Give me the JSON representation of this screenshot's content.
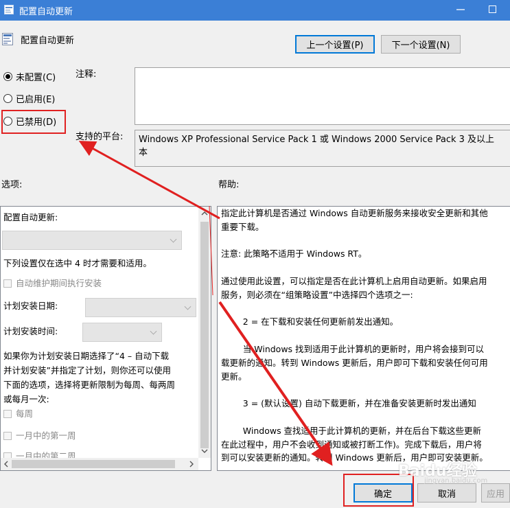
{
  "window": {
    "title": "配置自动更新",
    "header": "配置自动更新"
  },
  "nav": {
    "prev_label": "上一个设置(P)",
    "next_label": "下一个设置(N)"
  },
  "state": {
    "not_configured": "未配置(C)",
    "enabled": "已启用(E)",
    "disabled": "已禁用(D)",
    "selected": "not_configured"
  },
  "comment": {
    "label": "注释:",
    "value": ""
  },
  "platform": {
    "label": "支持的平台:",
    "value": "Windows XP Professional Service Pack 1 或 Windows 2000 Service Pack 3 及以上",
    "value_cont": "本"
  },
  "options": {
    "label": "选项:",
    "configure_label": "配置自动更新:",
    "configure_value": "",
    "note": "下列设置仅在选中 4 时才需要和适用。",
    "maintenance": "自动维护期间执行安装",
    "schedule_day_label": "计划安装日期:",
    "schedule_day_value": "",
    "schedule_time_label": "计划安装时间:",
    "schedule_time_value": "",
    "para": [
      "如果你为计划安装日期选择了“4 – 自动下载",
      "并计划安装”并指定了计划，则你还可以使用",
      "下面的选项，选择将更新限制为每周、每两周",
      "或每月一次:"
    ],
    "weekly": "每周",
    "first_week": "一月中的第一周",
    "second_week": "一月中的第二周"
  },
  "help": {
    "label": "帮助:",
    "lines": [
      "指定此计算机是否通过 Windows 自动更新服务来接收安全更新和其他",
      "重要下载。",
      "",
      "注意: 此策略不适用于 Windows RT。",
      "",
      "通过使用此设置，可以指定是否在此计算机上启用自动更新。如果启用",
      "服务，则必须在“组策略设置”中选择四个选项之一:",
      "",
      "        2 = 在下载和安装任何更新前发出通知。",
      "",
      "        当 Windows 找到适用于此计算机的更新时，用户将会接到可以",
      "载更新的通知。转到 Windows 更新后，用户即可下载和安装任何可用",
      "更新。",
      "",
      "        3 = (默认设置) 自动下载更新，并在准备安装更新时发出通知",
      "",
      "        Windows 查找适用于此计算机的更新，并在后台下载这些更新",
      "在此过程中，用户不会收到通知或被打断工作)。完成下载后，用户将",
      "到可以安装更新的通知。转到 Windows 更新后，用户即可安装更新。"
    ]
  },
  "footer": {
    "ok_label": "确定",
    "cancel_label": "取消",
    "apply_label": "应用"
  },
  "watermark": {
    "brand": "Baidu经验",
    "url": "jingyan.baidu.com"
  },
  "colors": {
    "titlebar": "#3b7fd6",
    "annotation_red": "#e02020",
    "accent_blue": "#0078d7"
  }
}
